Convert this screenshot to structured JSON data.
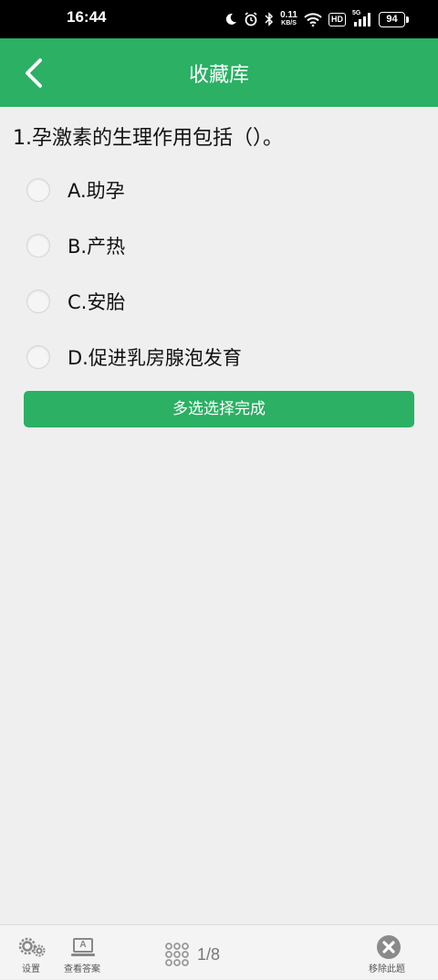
{
  "status_bar": {
    "time": "16:44",
    "net_speed": "0.11",
    "net_unit": "KB/S",
    "hd": "HD",
    "signal_label": "5G",
    "battery": "94"
  },
  "header": {
    "title": "收藏库",
    "color": "#2bb064"
  },
  "question": {
    "text": "1.孕激素的生理作用包括（）。",
    "options": [
      {
        "label": "A.助孕"
      },
      {
        "label": "B.产热"
      },
      {
        "label": "C.安胎"
      },
      {
        "label": "D.促进乳房腺泡发育"
      }
    ],
    "submit_label": "多选选择完成"
  },
  "bottom_bar": {
    "settings_label": "设置",
    "answer_label": "查看答案",
    "answer_icon_letter": "A",
    "page_indicator": "1/8",
    "remove_label": "移除此题"
  }
}
